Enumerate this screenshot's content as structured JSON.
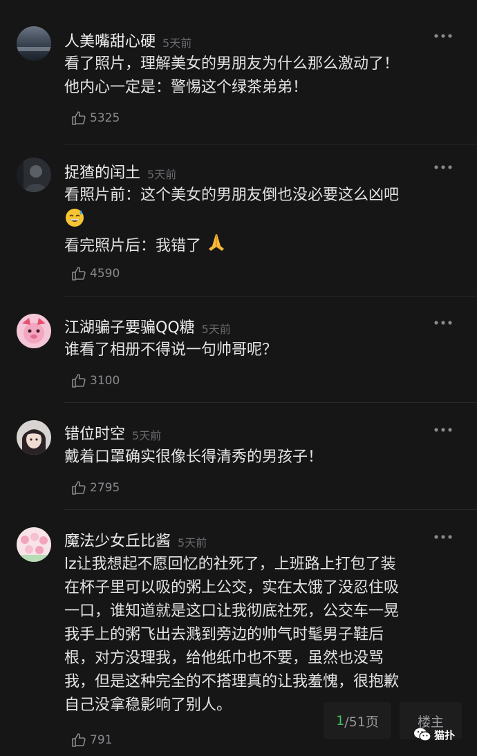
{
  "comments": [
    {
      "username": "人美嘴甜心硬",
      "time": "5天前",
      "lines": [
        "看了照片，理解美女的男朋友为什么那么激动了！",
        "他内心一定是：警惕这个绿茶弟弟！"
      ],
      "likes": "5325"
    },
    {
      "username": "捉猹的闰土",
      "time": "5天前",
      "lines": [
        "看照片前：这个美女的男朋友倒也没必要这么凶吧",
        "",
        "看完照片后：我错了"
      ],
      "likes": "4590"
    },
    {
      "username": "江湖骗子要骗QQ糖",
      "time": "5天前",
      "lines": [
        "谁看了相册不得说一句帅哥呢？"
      ],
      "likes": "3100"
    },
    {
      "username": "错位时空",
      "time": "5天前",
      "lines": [
        "戴着口罩确实很像长得清秀的男孩子！"
      ],
      "likes": "2795"
    },
    {
      "username": "魔法少女丘比酱",
      "time": "5天前",
      "lines": [
        "lz让我想起不愿回忆的社死了，上班路上打包了装",
        "在杯子里可以吸的粥上公交，实在太饿了没忍住吸",
        "一口，谁知道就是这口让我彻底社死，公交车一晃",
        "我手上的粥飞出去溅到旁边的帅气时髦男子鞋后",
        "根，对方没理我，给他纸巾也不要，虽然也没骂",
        "我，但是这种完全的不搭理真的让我羞愧，很抱歉",
        "自己没拿稳影响了别人。"
      ],
      "likes": "791"
    }
  ],
  "pager": {
    "current": "1",
    "total": "/51页"
  },
  "owner_button": "楼主",
  "watermark": "猫扑",
  "colors": {
    "background": "#161617",
    "text": "#e3e3e3",
    "muted": "#6a6a6e",
    "pager_current": "#3fbf62"
  },
  "icons": {
    "more": "more-dots-icon",
    "like": "thumbs-up-icon",
    "emoji_sweat_smile": "grinning-sweat-emoji",
    "emoji_pray": "folded-hands-emoji",
    "wechat": "wechat-icon"
  }
}
